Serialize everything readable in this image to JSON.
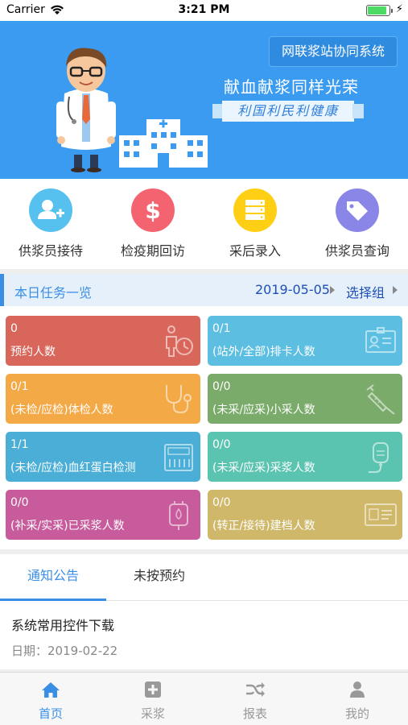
{
  "status_bar": {
    "carrier": "Carrier",
    "time": "3:21 PM",
    "battery_level": 0.9
  },
  "banner": {
    "system_button": "网联浆站协同系统",
    "slogan": "献血献浆同样光荣",
    "slogan2": "利国利民利健康"
  },
  "actions": [
    {
      "label": "供浆员接待",
      "icon": "add-user-icon",
      "color": "#56c0ee"
    },
    {
      "label": "检疫期回访",
      "icon": "dollar-icon",
      "color": "#f46470"
    },
    {
      "label": "采后录入",
      "icon": "server-icon",
      "color": "#ffcf16"
    },
    {
      "label": "供浆员查询",
      "icon": "tag-icon",
      "color": "#8a86e8"
    }
  ],
  "task": {
    "title": "本日任务一览",
    "date": "2019-05-05",
    "group_label": "选择组"
  },
  "cards": [
    {
      "num": "0",
      "text": "预约人数",
      "color": "#d9665b",
      "icon": "person-clock-icon"
    },
    {
      "num": "0/1",
      "text": "(站外/全部)排卡人数",
      "color": "#5cbfe2",
      "icon": "id-badge-icon"
    },
    {
      "num": "0/1",
      "text": "(未检/应检)体检人数",
      "color": "#f4a947",
      "icon": "stethoscope-icon"
    },
    {
      "num": "0/0",
      "text": "(未采/应采)小采人数",
      "color": "#7aab6a",
      "icon": "syringe-icon"
    },
    {
      "num": "1/1",
      "text": "(未检/应检)血红蛋白检测",
      "color": "#4aaed6",
      "icon": "analyzer-icon"
    },
    {
      "num": "0/0",
      "text": "(未采/应采)采浆人数",
      "color": "#5bc4b0",
      "icon": "plasma-bag-icon"
    },
    {
      "num": "0/0",
      "text": "(补采/实采)已采浆人数",
      "color": "#c75b9b",
      "icon": "blood-bag-icon"
    },
    {
      "num": "0/0",
      "text": "(转正/接待)建档人数",
      "color": "#d0b86a",
      "icon": "id-card-icon"
    }
  ],
  "tabs": [
    {
      "label": "通知公告",
      "active": true
    },
    {
      "label": "未按预约",
      "active": false
    }
  ],
  "notice": {
    "title": "系统常用控件下载",
    "date_label": "日期：",
    "date": "2019-02-22"
  },
  "bottom_nav": [
    {
      "label": "首页",
      "icon": "home-icon",
      "active": true
    },
    {
      "label": "采浆",
      "icon": "plus-square-icon",
      "active": false
    },
    {
      "label": "报表",
      "icon": "shuffle-icon",
      "active": false
    },
    {
      "label": "我的",
      "icon": "user-icon",
      "active": false
    }
  ]
}
